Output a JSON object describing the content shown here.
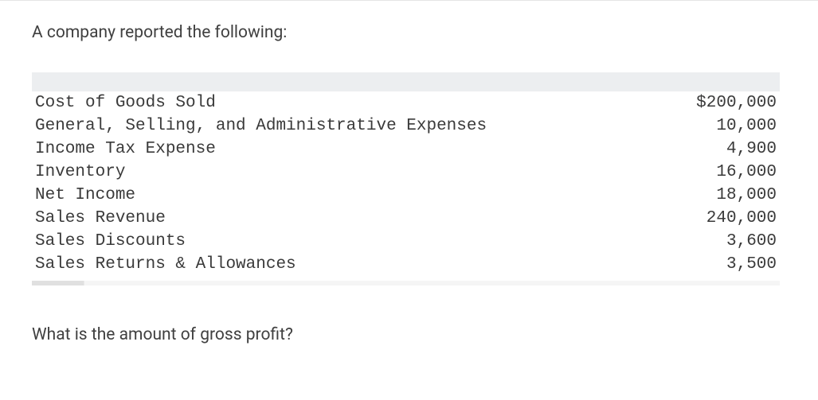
{
  "intro": "A company reported the following:",
  "rows": [
    {
      "label": "Cost of Goods Sold",
      "value": "$200,000"
    },
    {
      "label": "General, Selling, and Administrative Expenses",
      "value": "10,000"
    },
    {
      "label": "Income Tax Expense",
      "value": "4,900"
    },
    {
      "label": "Inventory",
      "value": "16,000"
    },
    {
      "label": "Net Income",
      "value": "18,000"
    },
    {
      "label": "Sales Revenue",
      "value": "240,000"
    },
    {
      "label": "Sales Discounts",
      "value": "3,600"
    },
    {
      "label": "Sales Returns & Allowances",
      "value": "3,500"
    }
  ],
  "question": "What is the amount of gross profit?"
}
